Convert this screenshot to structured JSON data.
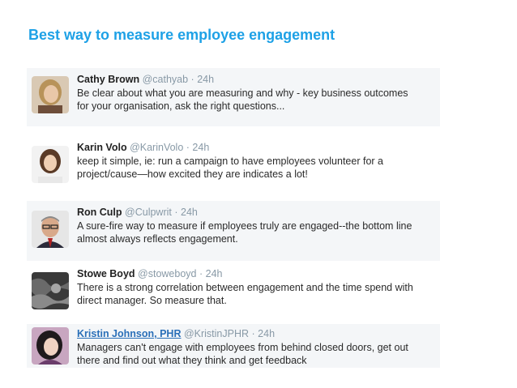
{
  "title": "Best way to measure employee engagement",
  "tweets": [
    {
      "name": "Cathy Brown",
      "handle": "@cathyab",
      "dot": "·",
      "time": "24h",
      "lines": [
        "Be clear about what you are measuring and why - key business outcomes",
        "for your organisation, ask the right questions..."
      ],
      "avatar_icon": "avatar-woman-blonde"
    },
    {
      "name": "Karin Volo",
      "handle": "@KarinVolo",
      "dot": "·",
      "time": "24h",
      "lines": [
        "keep it simple, ie: run a campaign to have employees volunteer for a",
        "project/cause—how excited they are indicates a lot!"
      ],
      "avatar_icon": "avatar-woman-dark-hair"
    },
    {
      "name": "Ron Culp",
      "handle": "@Culpwrit",
      "dot": "·",
      "time": "24h",
      "lines": [
        "A sure-fire way to measure if employees truly are engaged--the bottom line",
        "almost always reflects engagement."
      ],
      "avatar_icon": "avatar-man-glasses"
    },
    {
      "name": "Stowe Boyd",
      "handle": "@stoweboyd",
      "dot": "·",
      "time": "24h",
      "lines": [
        "There is a strong correlation between engagement and the time spend with",
        "direct manager. So measure that."
      ],
      "avatar_icon": "avatar-grayscale-texture"
    },
    {
      "name": "Kristin Johnson, PHR",
      "handle": "@KristinJPHR",
      "dot": "·",
      "time": "24h",
      "lines": [
        "Managers can't engage with employees from behind closed doors, get out",
        "there and find out what they think and get feedback"
      ],
      "avatar_icon": "avatar-woman-black-hair"
    }
  ]
}
